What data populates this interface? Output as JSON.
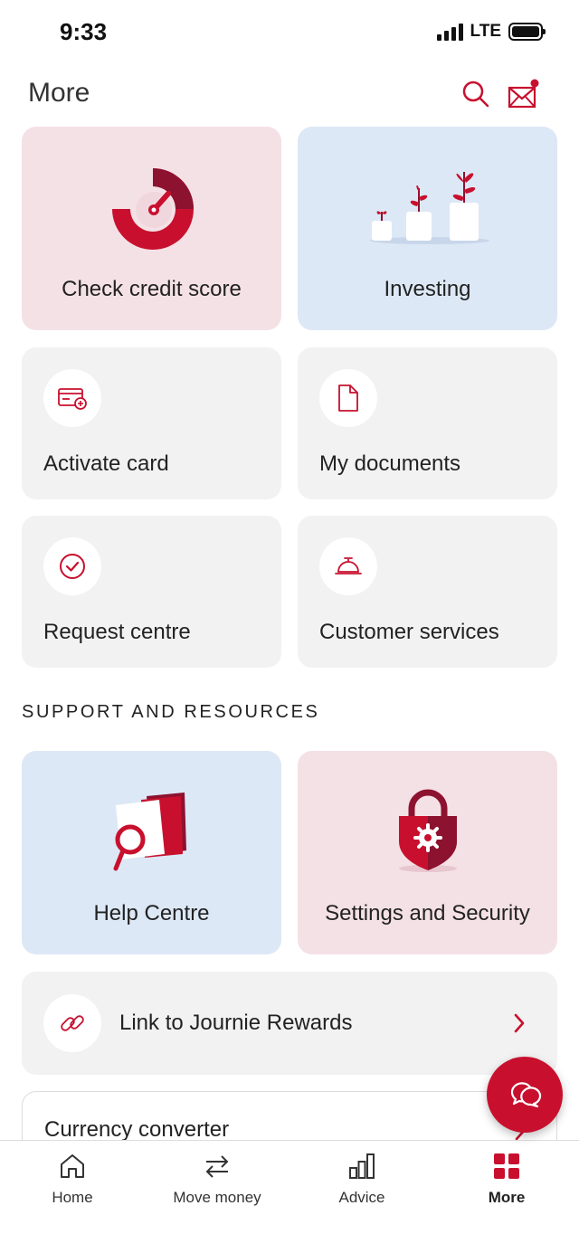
{
  "status_bar": {
    "time": "9:33",
    "network": "LTE"
  },
  "header": {
    "title": "More"
  },
  "tiles": {
    "credit_score": "Check credit score",
    "investing": "Investing",
    "activate_card": "Activate card",
    "my_documents": "My documents",
    "request_centre": "Request centre",
    "customer_services": "Customer services"
  },
  "support": {
    "heading": "SUPPORT AND RESOURCES",
    "help_centre": "Help Centre",
    "settings_security": "Settings and Security"
  },
  "list": {
    "journie": "Link to Journie Rewards",
    "currency": "Currency converter"
  },
  "nav": {
    "items": [
      {
        "label": "Home",
        "icon": "home-icon"
      },
      {
        "label": "Move money",
        "icon": "transfer-icon"
      },
      {
        "label": "Advice",
        "icon": "bar-chart-icon"
      },
      {
        "label": "More",
        "icon": "grid-icon",
        "active": true
      }
    ]
  },
  "colors": {
    "brand_red": "#c8102e",
    "pink_tile": "#f4e1e6",
    "blue_tile": "#dde8f6",
    "grey_tile": "#f2f2f2"
  }
}
